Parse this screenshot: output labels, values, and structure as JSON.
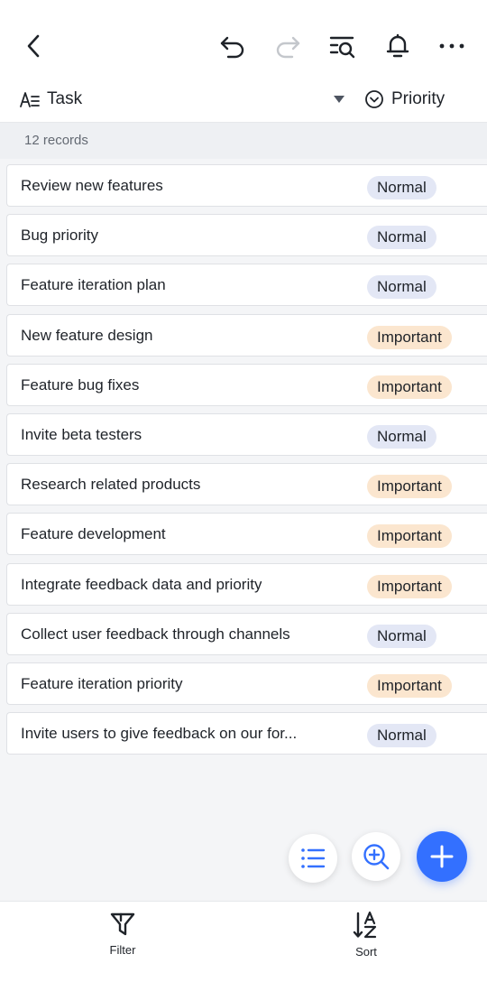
{
  "toolbar": {
    "back_icon": "chevron-left-icon",
    "undo_icon": "undo-icon",
    "redo_icon": "redo-icon",
    "search_records_icon": "search-list-icon",
    "notifications_icon": "bell-icon",
    "more_icon": "more-horizontal-icon"
  },
  "columns": {
    "task_label": "Task",
    "priority_label": "Priority"
  },
  "records_count": "12 records",
  "records": [
    {
      "task": "Review new features",
      "priority": "Normal"
    },
    {
      "task": "Bug priority",
      "priority": "Normal"
    },
    {
      "task": "Feature iteration plan",
      "priority": "Normal"
    },
    {
      "task": "New feature design",
      "priority": "Important"
    },
    {
      "task": "Feature bug fixes",
      "priority": "Important"
    },
    {
      "task": "Invite beta testers",
      "priority": "Normal"
    },
    {
      "task": "Research related products",
      "priority": "Important"
    },
    {
      "task": "Feature development",
      "priority": "Important"
    },
    {
      "task": "Integrate feedback data and priority",
      "priority": "Important"
    },
    {
      "task": "Collect user feedback through channels",
      "priority": "Normal"
    },
    {
      "task": "Feature iteration priority",
      "priority": "Important"
    },
    {
      "task": "Invite users to give feedback on our for...",
      "priority": "Normal"
    }
  ],
  "bottom": {
    "filter_label": "Filter",
    "sort_label": "Sort"
  },
  "colors": {
    "accent": "#3370ff",
    "normal_tag_bg": "#e3e7f5",
    "important_tag_bg": "#fbe6cf"
  }
}
